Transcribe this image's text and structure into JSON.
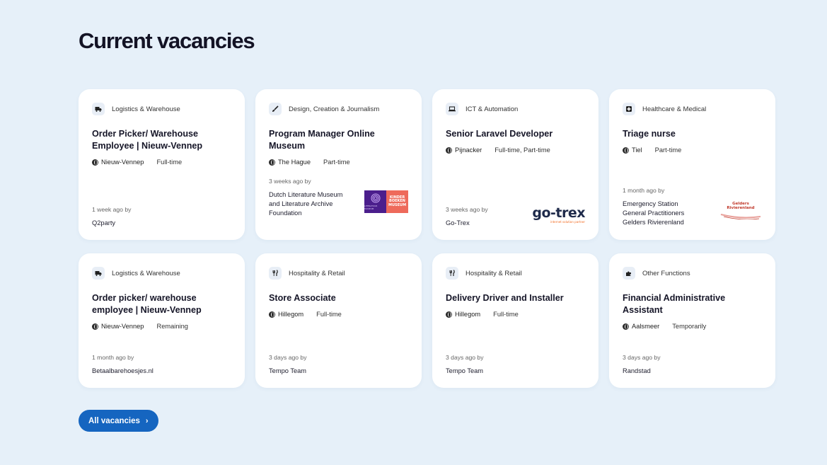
{
  "page": {
    "title": "Current vacancies"
  },
  "vacancies": [
    {
      "category": "Logistics & Warehouse",
      "icon": "truck-icon",
      "title": "Order Picker/ Warehouse Employee | Nieuw-Vennep",
      "location": "Nieuw-Vennep",
      "type": "Full-time",
      "posted": "1 week ago by",
      "company": "Q2party"
    },
    {
      "category": "Design, Creation & Journalism",
      "icon": "brush-icon",
      "title": "Program Manager Online Museum",
      "location": "The Hague",
      "type": "Part-time",
      "posted": "3 weeks ago by",
      "company": "Dutch Literature Museum and Literature Archive Foundation",
      "logo_text": "LITERATUUR MUSEUM",
      "logo_text2": "KINDER BOEKEN MUSEUM"
    },
    {
      "category": "ICT & Automation",
      "icon": "laptop-icon",
      "title": "Senior Laravel Developer",
      "location": "Pijnacker",
      "type": "Full-time, Part-time",
      "posted": "3 weeks ago by",
      "company": "Go-Trex",
      "logo_text": "go-trex",
      "logo_sub": "internet solution partner"
    },
    {
      "category": "Healthcare & Medical",
      "icon": "medical-cross-icon",
      "title": "Triage nurse",
      "location": "Tiel",
      "type": "Part-time",
      "posted": "1 month ago by",
      "company": "Emergency Station General Practitioners Gelders Rivierenland",
      "logo_text": "Gelders Rivierenland"
    },
    {
      "category": "Logistics & Warehouse",
      "icon": "truck-icon",
      "title": "Order picker/ warehouse employee | Nieuw-Vennep",
      "location": "Nieuw-Vennep",
      "type": "Remaining",
      "posted": "1 month ago by",
      "company": "Betaalbarehoesjes.nl"
    },
    {
      "category": "Hospitality & Retail",
      "icon": "cutlery-icon",
      "title": "Store Associate",
      "location": "Hillegom",
      "type": "Full-time",
      "posted": "3 days ago by",
      "company": "Tempo Team"
    },
    {
      "category": "Hospitality & Retail",
      "icon": "cutlery-icon",
      "title": "Delivery Driver and Installer",
      "location": "Hillegom",
      "type": "Full-time",
      "posted": "3 days ago by",
      "company": "Tempo Team"
    },
    {
      "category": "Other Functions",
      "icon": "puzzle-icon",
      "title": "Financial Administrative Assistant",
      "location": "Aalsmeer",
      "type": "Temporarily",
      "posted": "3 days ago by",
      "company": "Randstad"
    }
  ],
  "button": {
    "label": "All vacancies"
  },
  "colors": {
    "background": "#e6f0f9",
    "button": "#1565c0",
    "gotrex_orange": "#f26b21",
    "lit_purple": "#4b1e8c",
    "lit_coral": "#ee6a5b"
  }
}
